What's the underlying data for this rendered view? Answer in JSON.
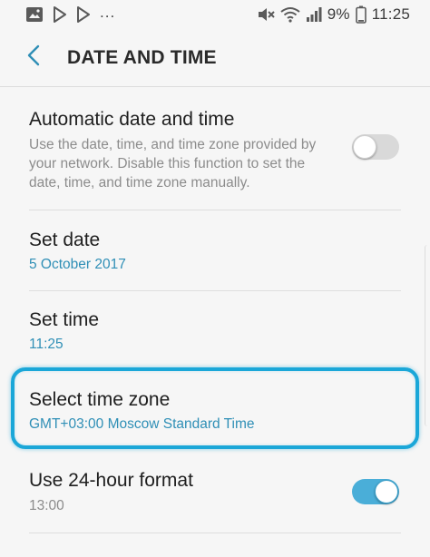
{
  "status_bar": {
    "overflow": "...",
    "battery": "9%",
    "time": "11:25",
    "icons_left": [
      "gallery-icon",
      "play-store-icon",
      "play-store-icon"
    ],
    "icons_right": [
      "mute-icon",
      "wifi-icon",
      "signal-icon",
      "battery-icon"
    ]
  },
  "header": {
    "title": "DATE AND TIME"
  },
  "settings": {
    "auto_datetime": {
      "title": "Automatic date and time",
      "description": "Use the date, time, and time zone provided by your network. Disable this function to set the date, time, and time zone manually.",
      "enabled": false
    },
    "set_date": {
      "title": "Set date",
      "value": "5 October 2017"
    },
    "set_time": {
      "title": "Set time",
      "value": "11:25"
    },
    "time_zone": {
      "title": "Select time zone",
      "value": "GMT+03:00 Moscow Standard Time"
    },
    "format_24h": {
      "title": "Use 24-hour format",
      "value": "13:00",
      "enabled": true
    }
  },
  "colors": {
    "accent": "#2f8fb6",
    "toggle_on": "#4aaed8",
    "highlight": "#1ba7d8"
  }
}
